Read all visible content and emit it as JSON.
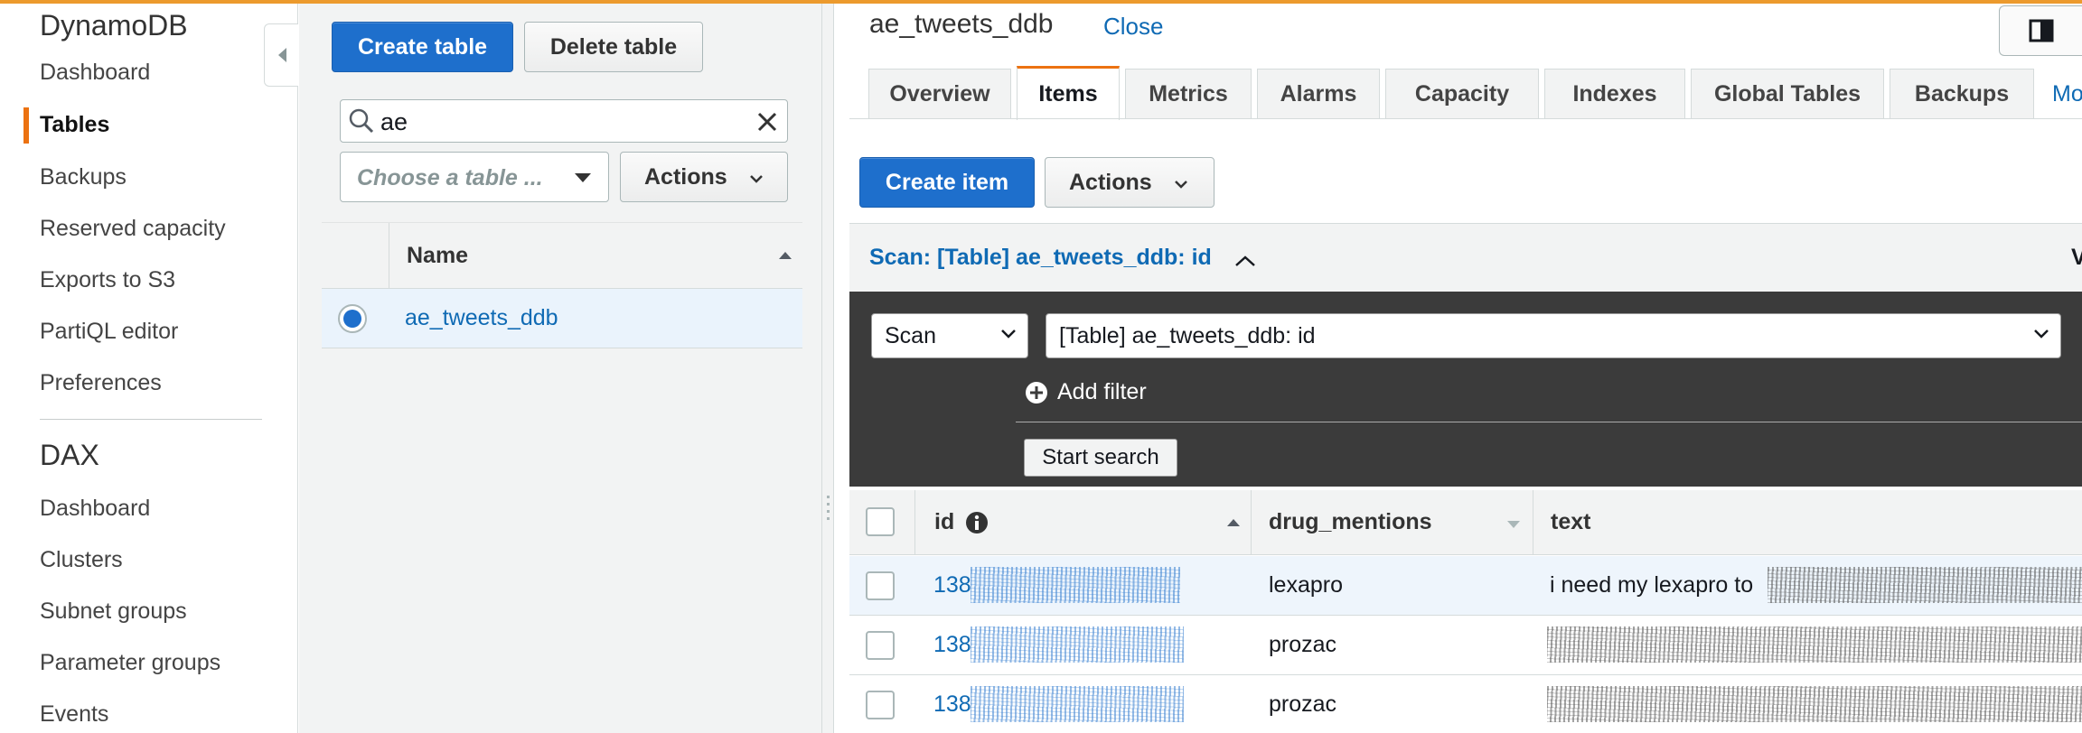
{
  "nav": {
    "dynamodb_title": "DynamoDB",
    "dynamodb_items": [
      "Dashboard",
      "Tables",
      "Backups",
      "Reserved capacity",
      "Exports to S3",
      "PartiQL editor",
      "Preferences"
    ],
    "active_item": "Tables",
    "dax_title": "DAX",
    "dax_items": [
      "Dashboard",
      "Clusters",
      "Subnet groups",
      "Parameter groups",
      "Events"
    ]
  },
  "table_list": {
    "create_button": "Create table",
    "delete_button": "Delete table",
    "search_value": "ae",
    "choose_placeholder": "Choose a table ...",
    "actions_button": "Actions",
    "column_name": "Name",
    "rows": [
      {
        "name": "ae_tweets_ddb",
        "selected": true
      }
    ]
  },
  "detail": {
    "table_name": "ae_tweets_ddb",
    "close_link": "Close",
    "tabs": [
      "Overview",
      "Items",
      "Metrics",
      "Alarms",
      "Capacity",
      "Indexes",
      "Global Tables",
      "Backups",
      "More"
    ],
    "active_tab": "Items",
    "create_item_button": "Create item",
    "actions_button": "Actions",
    "scan_header": "Scan: [Table] ae_tweets_ddb: id",
    "scan_header_trailing": "V",
    "scan_mode": "Scan",
    "scan_target": "[Table] ae_tweets_ddb: id",
    "add_filter": "Add filter",
    "start_search": "Start search",
    "columns": [
      "id",
      "drug_mentions",
      "text"
    ],
    "rows": [
      {
        "id": "138",
        "drug_mentions": "lexapro",
        "text": "i need my lexapro to",
        "highlighted": true
      },
      {
        "id": "138",
        "drug_mentions": "prozac",
        "text": ""
      },
      {
        "id": "138",
        "drug_mentions": "prozac",
        "text": ""
      }
    ]
  },
  "colors": {
    "accent_orange": "#ec7211",
    "primary_blue": "#1e6fcc",
    "link_blue": "#0f6ab4",
    "scan_panel": "#3b3b3b"
  }
}
